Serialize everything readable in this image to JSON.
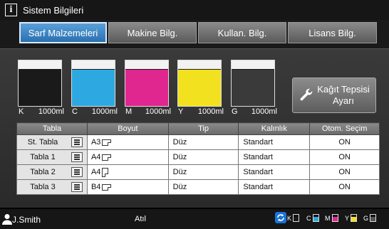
{
  "title_bar": {
    "icon": "info-icon",
    "title": "Sistem Bilgileri"
  },
  "tabs": [
    {
      "label": "Sarf Malzemeleri",
      "active": true
    },
    {
      "label": "Makine Bilg.",
      "active": false
    },
    {
      "label": "Kullan. Bilg.",
      "active": false
    },
    {
      "label": "Lisans Bilg.",
      "active": false
    }
  ],
  "inks": [
    {
      "channel": "K",
      "amount": "1000ml",
      "color": "#1a1a1a",
      "level": 0.8
    },
    {
      "channel": "C",
      "amount": "1000ml",
      "color": "#2ea8e0",
      "level": 0.8
    },
    {
      "channel": "M",
      "amount": "1000ml",
      "color": "#e0268f",
      "level": 0.8
    },
    {
      "channel": "Y",
      "amount": "1000ml",
      "color": "#f2e11e",
      "level": 0.8
    },
    {
      "channel": "G",
      "amount": "1000ml",
      "color": "#3a3a3a",
      "level": 0.8
    }
  ],
  "tray_button": {
    "icon": "wrench-icon",
    "line1": "Kağıt Tepsisi",
    "line2": "Ayarı"
  },
  "table": {
    "headers": [
      "Tabla",
      "Boyut",
      "Tip",
      "Kalınlık",
      "Otom. Seçim"
    ],
    "rows": [
      {
        "name": "St. Tabla",
        "size": "A3",
        "orientation": "landscape",
        "type": "Düz",
        "thickness": "Standart",
        "auto": "ON"
      },
      {
        "name": "Tabla 1",
        "size": "A4",
        "orientation": "landscape",
        "type": "Düz",
        "thickness": "Standart",
        "auto": "ON"
      },
      {
        "name": "Tabla 2",
        "size": "A4",
        "orientation": "portrait",
        "type": "Düz",
        "thickness": "Standart",
        "auto": "ON"
      },
      {
        "name": "Tabla 3",
        "size": "B4",
        "orientation": "landscape",
        "type": "Düz",
        "thickness": "Standart",
        "auto": "ON"
      }
    ]
  },
  "status_bar": {
    "user": "J.Smith",
    "status": "Atıl",
    "sync_icon": "sync-icon",
    "levels": [
      {
        "channel": "K",
        "color": "#1a1a1a",
        "level": 0.7
      },
      {
        "channel": "C",
        "color": "#2ea8e0",
        "level": 0.7
      },
      {
        "channel": "M",
        "color": "#e0268f",
        "level": 0.7
      },
      {
        "channel": "Y",
        "color": "#f2e11e",
        "level": 0.7
      },
      {
        "channel": "G",
        "color": "#555555",
        "level": 0.7
      }
    ]
  }
}
